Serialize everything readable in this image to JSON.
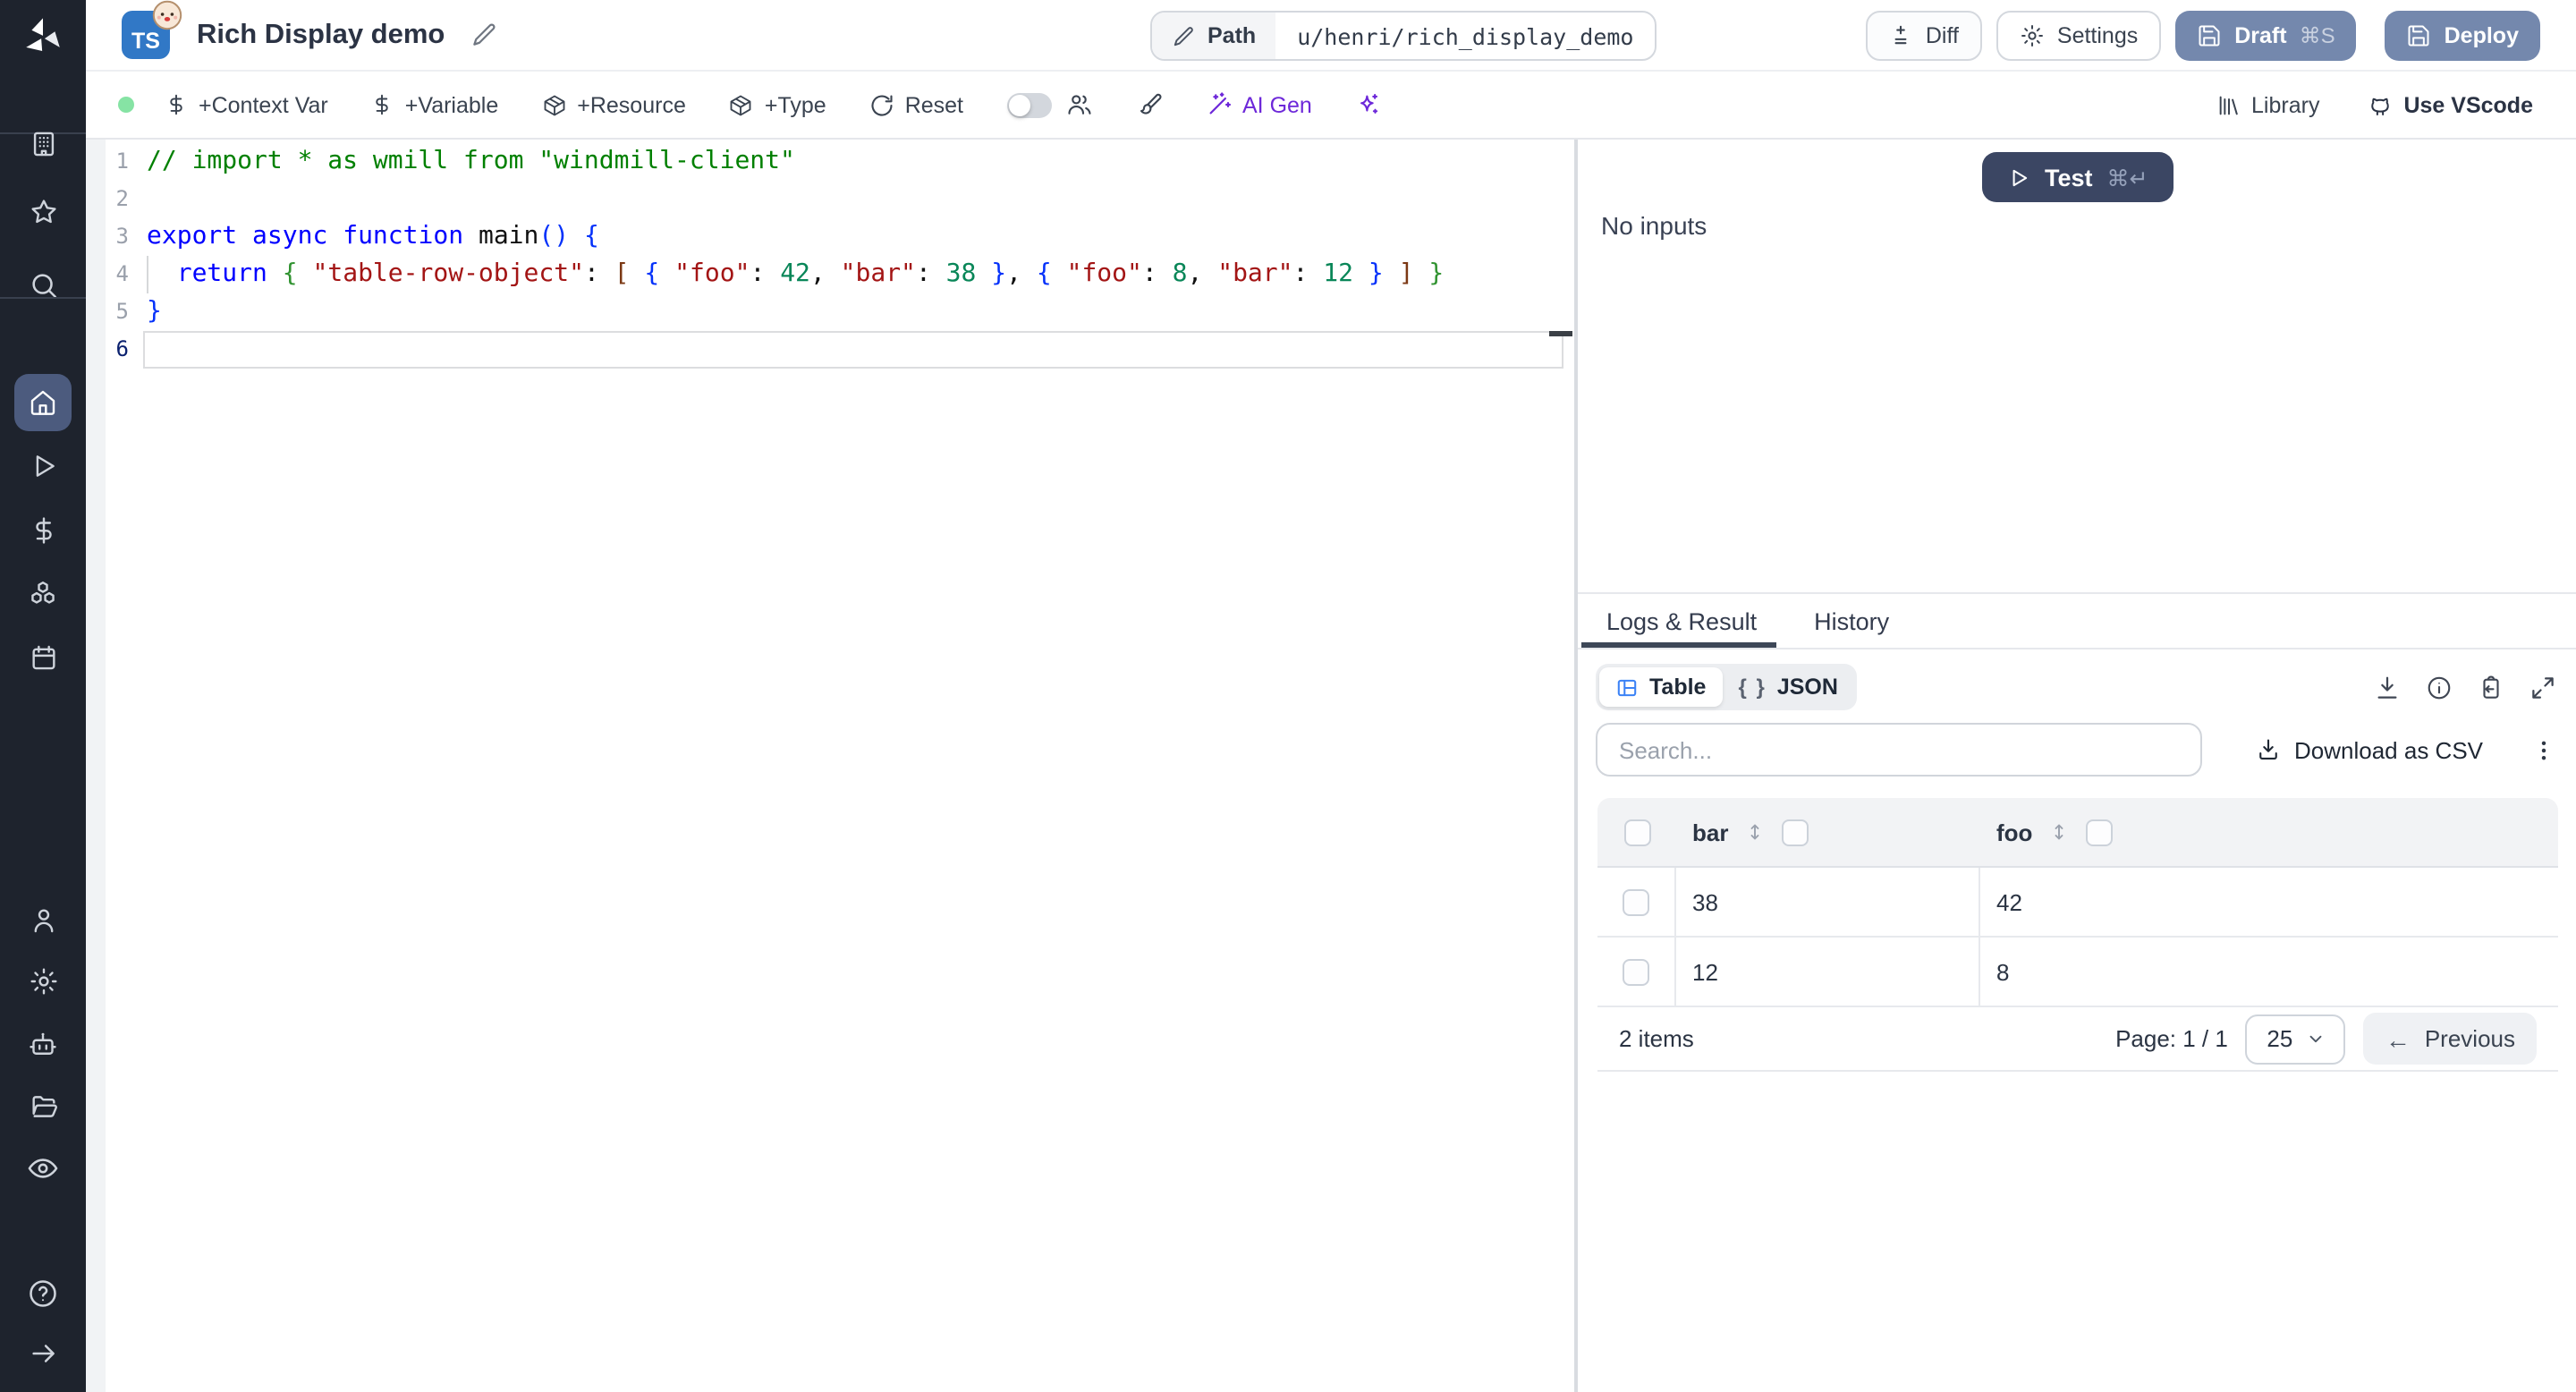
{
  "topbar": {
    "language_badge": "TS",
    "title": "Rich Display demo",
    "path": {
      "label": "Path",
      "value": "u/henri/rich_display_demo"
    },
    "buttons": {
      "diff": "Diff",
      "settings": "Settings",
      "draft": "Draft",
      "draft_shortcut": "⌘S",
      "deploy": "Deploy"
    }
  },
  "toolbar": {
    "add_context_var": "+Context Var",
    "add_variable": "+Variable",
    "add_resource": "+Resource",
    "add_type": "+Type",
    "reset": "Reset",
    "ai_gen": "AI Gen",
    "library": "Library",
    "use_vscode": "Use VScode"
  },
  "sidebar": {
    "items": [
      "workspace",
      "favorites",
      "search",
      "home",
      "runs",
      "variables",
      "resources",
      "schedules",
      "user",
      "settings",
      "workers",
      "folders",
      "audit-logs",
      "help",
      "expand"
    ],
    "active_item": "home"
  },
  "editor": {
    "language": "typescript",
    "lines": [
      {
        "n": 1,
        "tokens": [
          [
            "// import * as wmill from \"windmill-client\"",
            "com"
          ]
        ]
      },
      {
        "n": 2,
        "tokens": []
      },
      {
        "n": 3,
        "tokens": [
          [
            "export",
            "kw"
          ],
          [
            " ",
            ""
          ],
          [
            "async",
            "kw"
          ],
          [
            " ",
            ""
          ],
          [
            "function",
            "kw"
          ],
          [
            " ",
            ""
          ],
          [
            "main",
            ""
          ],
          [
            "()",
            "b1"
          ],
          [
            " ",
            ""
          ],
          [
            "{",
            "b1"
          ]
        ]
      },
      {
        "n": 4,
        "tokens": [
          [
            "  ",
            ""
          ],
          [
            "return",
            "kw"
          ],
          [
            " ",
            ""
          ],
          [
            "{",
            "b2"
          ],
          [
            " ",
            ""
          ],
          [
            "\"table-row-object\"",
            "str"
          ],
          [
            ": ",
            ""
          ],
          [
            "[",
            "b3"
          ],
          [
            " ",
            ""
          ],
          [
            "{",
            "b1"
          ],
          [
            " ",
            ""
          ],
          [
            "\"foo\"",
            "str"
          ],
          [
            ": ",
            ""
          ],
          [
            "42",
            "num"
          ],
          [
            ", ",
            ""
          ],
          [
            "\"bar\"",
            "str"
          ],
          [
            ": ",
            ""
          ],
          [
            "38",
            "num"
          ],
          [
            " ",
            ""
          ],
          [
            "}",
            "b1"
          ],
          [
            ", ",
            ""
          ],
          [
            "{",
            "b1"
          ],
          [
            " ",
            ""
          ],
          [
            "\"foo\"",
            "str"
          ],
          [
            ": ",
            ""
          ],
          [
            "8",
            "num"
          ],
          [
            ", ",
            ""
          ],
          [
            "\"bar\"",
            "str"
          ],
          [
            ": ",
            ""
          ],
          [
            "12",
            "num"
          ],
          [
            " ",
            ""
          ],
          [
            "}",
            "b1"
          ],
          [
            " ",
            ""
          ],
          [
            "]",
            "b3"
          ],
          [
            " ",
            ""
          ],
          [
            "}",
            "b2"
          ]
        ]
      },
      {
        "n": 5,
        "tokens": [
          [
            "}",
            "b1"
          ]
        ]
      },
      {
        "n": 6,
        "tokens": [],
        "current": true
      }
    ]
  },
  "run_panel": {
    "test_label": "Test",
    "test_shortcut": "⌘↵",
    "empty_inputs": "No inputs"
  },
  "result_panel": {
    "tabs": [
      {
        "label": "Logs & Result",
        "active": true
      },
      {
        "label": "History",
        "active": false
      }
    ],
    "view_modes": [
      {
        "label": "Table",
        "active": true
      },
      {
        "label": "JSON",
        "active": false
      }
    ],
    "json_braces": "{ }",
    "search_placeholder": "Search...",
    "download_csv_label": "Download as CSV",
    "table": {
      "columns": [
        "bar",
        "foo"
      ],
      "rows": [
        {
          "bar": "38",
          "foo": "42"
        },
        {
          "bar": "12",
          "foo": "8"
        }
      ],
      "items_count": "2 items",
      "page_label": "Page: 1 / 1",
      "page_size": "25",
      "previous_label": "Previous"
    }
  },
  "colors": {
    "sidebar_bg": "#1e232d",
    "active_item_bg": "#4c5b7e",
    "primary_button": "#7488ad",
    "test_button": "#3b4663",
    "ts_badge": "#3178c6",
    "ai_purple": "#6d28d9",
    "status_green": "#86e3a4",
    "table_icon_blue": "#3b82f6",
    "code": {
      "keyword": "#0000ff",
      "string": "#a31515",
      "number": "#098658",
      "comment": "#008000",
      "bracket1": "#0431fa",
      "bracket2": "#319331",
      "bracket3": "#7b3814"
    }
  }
}
